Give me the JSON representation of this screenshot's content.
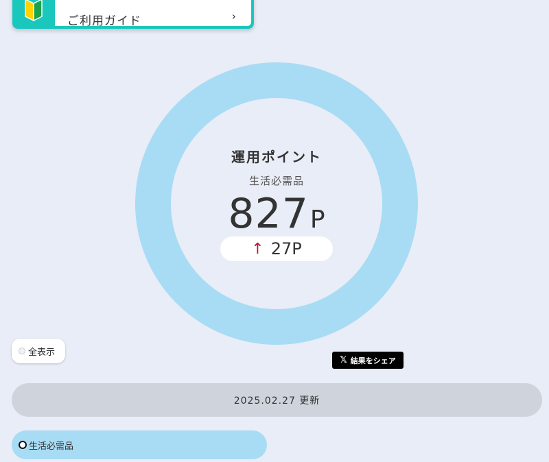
{
  "guide": {
    "label": "ご利用ガイド",
    "chevron": "›",
    "icon": "beginner-mark-icon",
    "colors": {
      "frame": "#19c7bd",
      "mark_green": "#1aa34a",
      "mark_yellow": "#ffd400"
    }
  },
  "ring": {
    "title": "運用ポイント",
    "category": "生活必需品",
    "points": "827",
    "unit": "P",
    "delta_arrow": "↑",
    "delta": "27P",
    "colors": {
      "ring": "#a8dcf4",
      "arrow": "#c0163f"
    }
  },
  "filters": {
    "show_all": "全表示"
  },
  "share": {
    "icon": "x-logo-icon",
    "x_glyph": "𝕏",
    "label": "結果をシェア"
  },
  "update": {
    "text": "2025.02.27 更新"
  },
  "category_chip": {
    "label": "生活必需品"
  }
}
